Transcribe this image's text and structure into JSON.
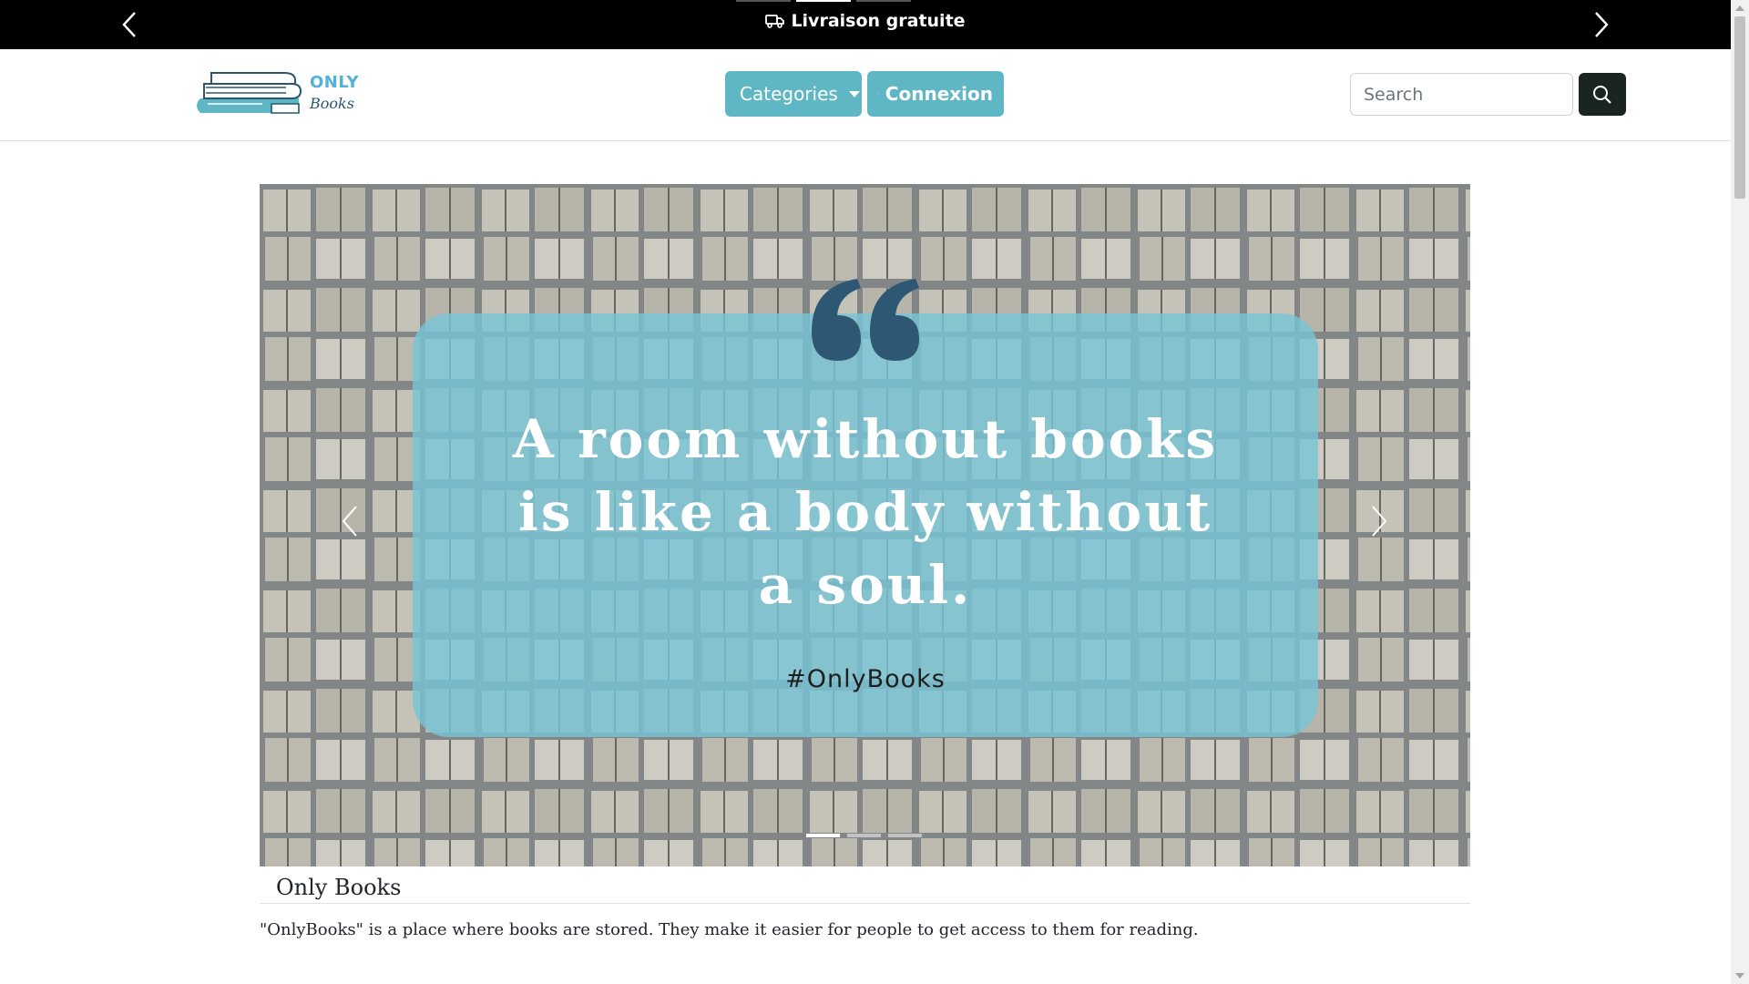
{
  "announcement": {
    "text": "Livraison gratuite",
    "icon": "truck-icon",
    "slides": 3,
    "active_slide": 2
  },
  "navbar": {
    "logo": {
      "word_top": "ONLY",
      "word_bottom": "Books"
    },
    "categories_label": "Categories",
    "login_label": "Connexion",
    "search_placeholder": "Search",
    "accent_color": "#5fb7c6"
  },
  "hero": {
    "quote": "A room without books is like a body without a soul.",
    "quote_lines": [
      "A room without books",
      "is like a body without",
      "a soul."
    ],
    "hashtag": "#OnlyBooks",
    "slides": 3,
    "active_slide": 1,
    "overlay_color": "#78c4d6"
  },
  "intro": {
    "title": "Only Books",
    "text": "\"OnlyBooks\" is a place where books are stored. They make it easier for people to get access to them for reading."
  }
}
